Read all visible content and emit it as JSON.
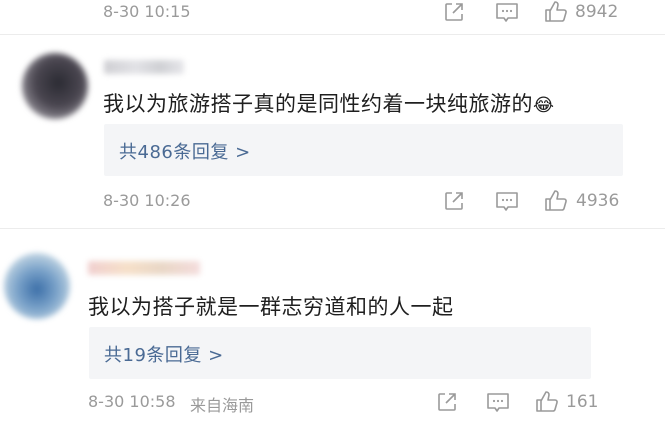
{
  "comments": [
    {
      "time": "8-30 10:15",
      "likes": "8942"
    },
    {
      "text": "我以为旅游搭子真的是同性约着一块纯旅游的",
      "emoji": "😂",
      "reply_link": "共486条回复 >",
      "time": "8-30 10:26",
      "likes": "4936"
    },
    {
      "text": "我以为搭子就是一群志穷道和的人一起",
      "reply_link": "共19条回复 >",
      "time": "8-30 10:58",
      "location": "来自海南",
      "likes": "161"
    }
  ],
  "icons": {
    "share": "share-icon",
    "comment": "comment-icon",
    "like": "thumbs-up-icon"
  },
  "colors": {
    "link": "#4a6a94",
    "meta": "#9a9a9a",
    "reply_bg": "#f4f5f7"
  }
}
